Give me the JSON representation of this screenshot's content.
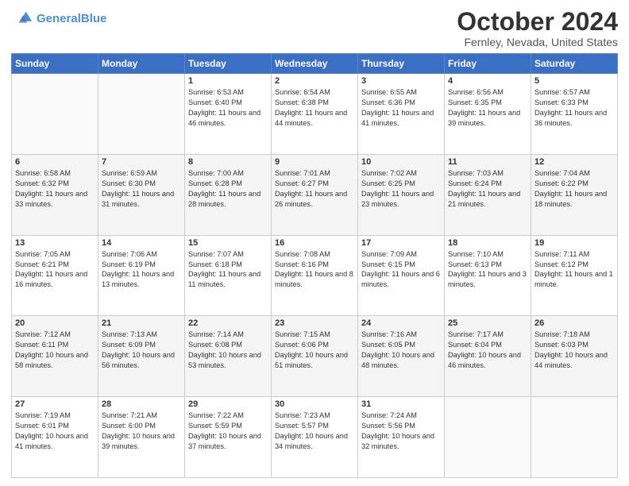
{
  "header": {
    "logo_line1": "General",
    "logo_line2": "Blue",
    "month": "October 2024",
    "location": "Fernley, Nevada, United States"
  },
  "days_of_week": [
    "Sunday",
    "Monday",
    "Tuesday",
    "Wednesday",
    "Thursday",
    "Friday",
    "Saturday"
  ],
  "weeks": [
    [
      {
        "day": "",
        "info": ""
      },
      {
        "day": "",
        "info": ""
      },
      {
        "day": "1",
        "info": "Sunrise: 6:53 AM\nSunset: 6:40 PM\nDaylight: 11 hours and 46 minutes."
      },
      {
        "day": "2",
        "info": "Sunrise: 6:54 AM\nSunset: 6:38 PM\nDaylight: 11 hours and 44 minutes."
      },
      {
        "day": "3",
        "info": "Sunrise: 6:55 AM\nSunset: 6:36 PM\nDaylight: 11 hours and 41 minutes."
      },
      {
        "day": "4",
        "info": "Sunrise: 6:56 AM\nSunset: 6:35 PM\nDaylight: 11 hours and 39 minutes."
      },
      {
        "day": "5",
        "info": "Sunrise: 6:57 AM\nSunset: 6:33 PM\nDaylight: 11 hours and 36 minutes."
      }
    ],
    [
      {
        "day": "6",
        "info": "Sunrise: 6:58 AM\nSunset: 6:32 PM\nDaylight: 11 hours and 33 minutes."
      },
      {
        "day": "7",
        "info": "Sunrise: 6:59 AM\nSunset: 6:30 PM\nDaylight: 11 hours and 31 minutes."
      },
      {
        "day": "8",
        "info": "Sunrise: 7:00 AM\nSunset: 6:28 PM\nDaylight: 11 hours and 28 minutes."
      },
      {
        "day": "9",
        "info": "Sunrise: 7:01 AM\nSunset: 6:27 PM\nDaylight: 11 hours and 26 minutes."
      },
      {
        "day": "10",
        "info": "Sunrise: 7:02 AM\nSunset: 6:25 PM\nDaylight: 11 hours and 23 minutes."
      },
      {
        "day": "11",
        "info": "Sunrise: 7:03 AM\nSunset: 6:24 PM\nDaylight: 11 hours and 21 minutes."
      },
      {
        "day": "12",
        "info": "Sunrise: 7:04 AM\nSunset: 6:22 PM\nDaylight: 11 hours and 18 minutes."
      }
    ],
    [
      {
        "day": "13",
        "info": "Sunrise: 7:05 AM\nSunset: 6:21 PM\nDaylight: 11 hours and 16 minutes."
      },
      {
        "day": "14",
        "info": "Sunrise: 7:06 AM\nSunset: 6:19 PM\nDaylight: 11 hours and 13 minutes."
      },
      {
        "day": "15",
        "info": "Sunrise: 7:07 AM\nSunset: 6:18 PM\nDaylight: 11 hours and 11 minutes."
      },
      {
        "day": "16",
        "info": "Sunrise: 7:08 AM\nSunset: 6:16 PM\nDaylight: 11 hours and 8 minutes."
      },
      {
        "day": "17",
        "info": "Sunrise: 7:09 AM\nSunset: 6:15 PM\nDaylight: 11 hours and 6 minutes."
      },
      {
        "day": "18",
        "info": "Sunrise: 7:10 AM\nSunset: 6:13 PM\nDaylight: 11 hours and 3 minutes."
      },
      {
        "day": "19",
        "info": "Sunrise: 7:11 AM\nSunset: 6:12 PM\nDaylight: 11 hours and 1 minute."
      }
    ],
    [
      {
        "day": "20",
        "info": "Sunrise: 7:12 AM\nSunset: 6:11 PM\nDaylight: 10 hours and 58 minutes."
      },
      {
        "day": "21",
        "info": "Sunrise: 7:13 AM\nSunset: 6:09 PM\nDaylight: 10 hours and 56 minutes."
      },
      {
        "day": "22",
        "info": "Sunrise: 7:14 AM\nSunset: 6:08 PM\nDaylight: 10 hours and 53 minutes."
      },
      {
        "day": "23",
        "info": "Sunrise: 7:15 AM\nSunset: 6:06 PM\nDaylight: 10 hours and 51 minutes."
      },
      {
        "day": "24",
        "info": "Sunrise: 7:16 AM\nSunset: 6:05 PM\nDaylight: 10 hours and 48 minutes."
      },
      {
        "day": "25",
        "info": "Sunrise: 7:17 AM\nSunset: 6:04 PM\nDaylight: 10 hours and 46 minutes."
      },
      {
        "day": "26",
        "info": "Sunrise: 7:18 AM\nSunset: 6:03 PM\nDaylight: 10 hours and 44 minutes."
      }
    ],
    [
      {
        "day": "27",
        "info": "Sunrise: 7:19 AM\nSunset: 6:01 PM\nDaylight: 10 hours and 41 minutes."
      },
      {
        "day": "28",
        "info": "Sunrise: 7:21 AM\nSunset: 6:00 PM\nDaylight: 10 hours and 39 minutes."
      },
      {
        "day": "29",
        "info": "Sunrise: 7:22 AM\nSunset: 5:59 PM\nDaylight: 10 hours and 37 minutes."
      },
      {
        "day": "30",
        "info": "Sunrise: 7:23 AM\nSunset: 5:57 PM\nDaylight: 10 hours and 34 minutes."
      },
      {
        "day": "31",
        "info": "Sunrise: 7:24 AM\nSunset: 5:56 PM\nDaylight: 10 hours and 32 minutes."
      },
      {
        "day": "",
        "info": ""
      },
      {
        "day": "",
        "info": ""
      }
    ]
  ]
}
